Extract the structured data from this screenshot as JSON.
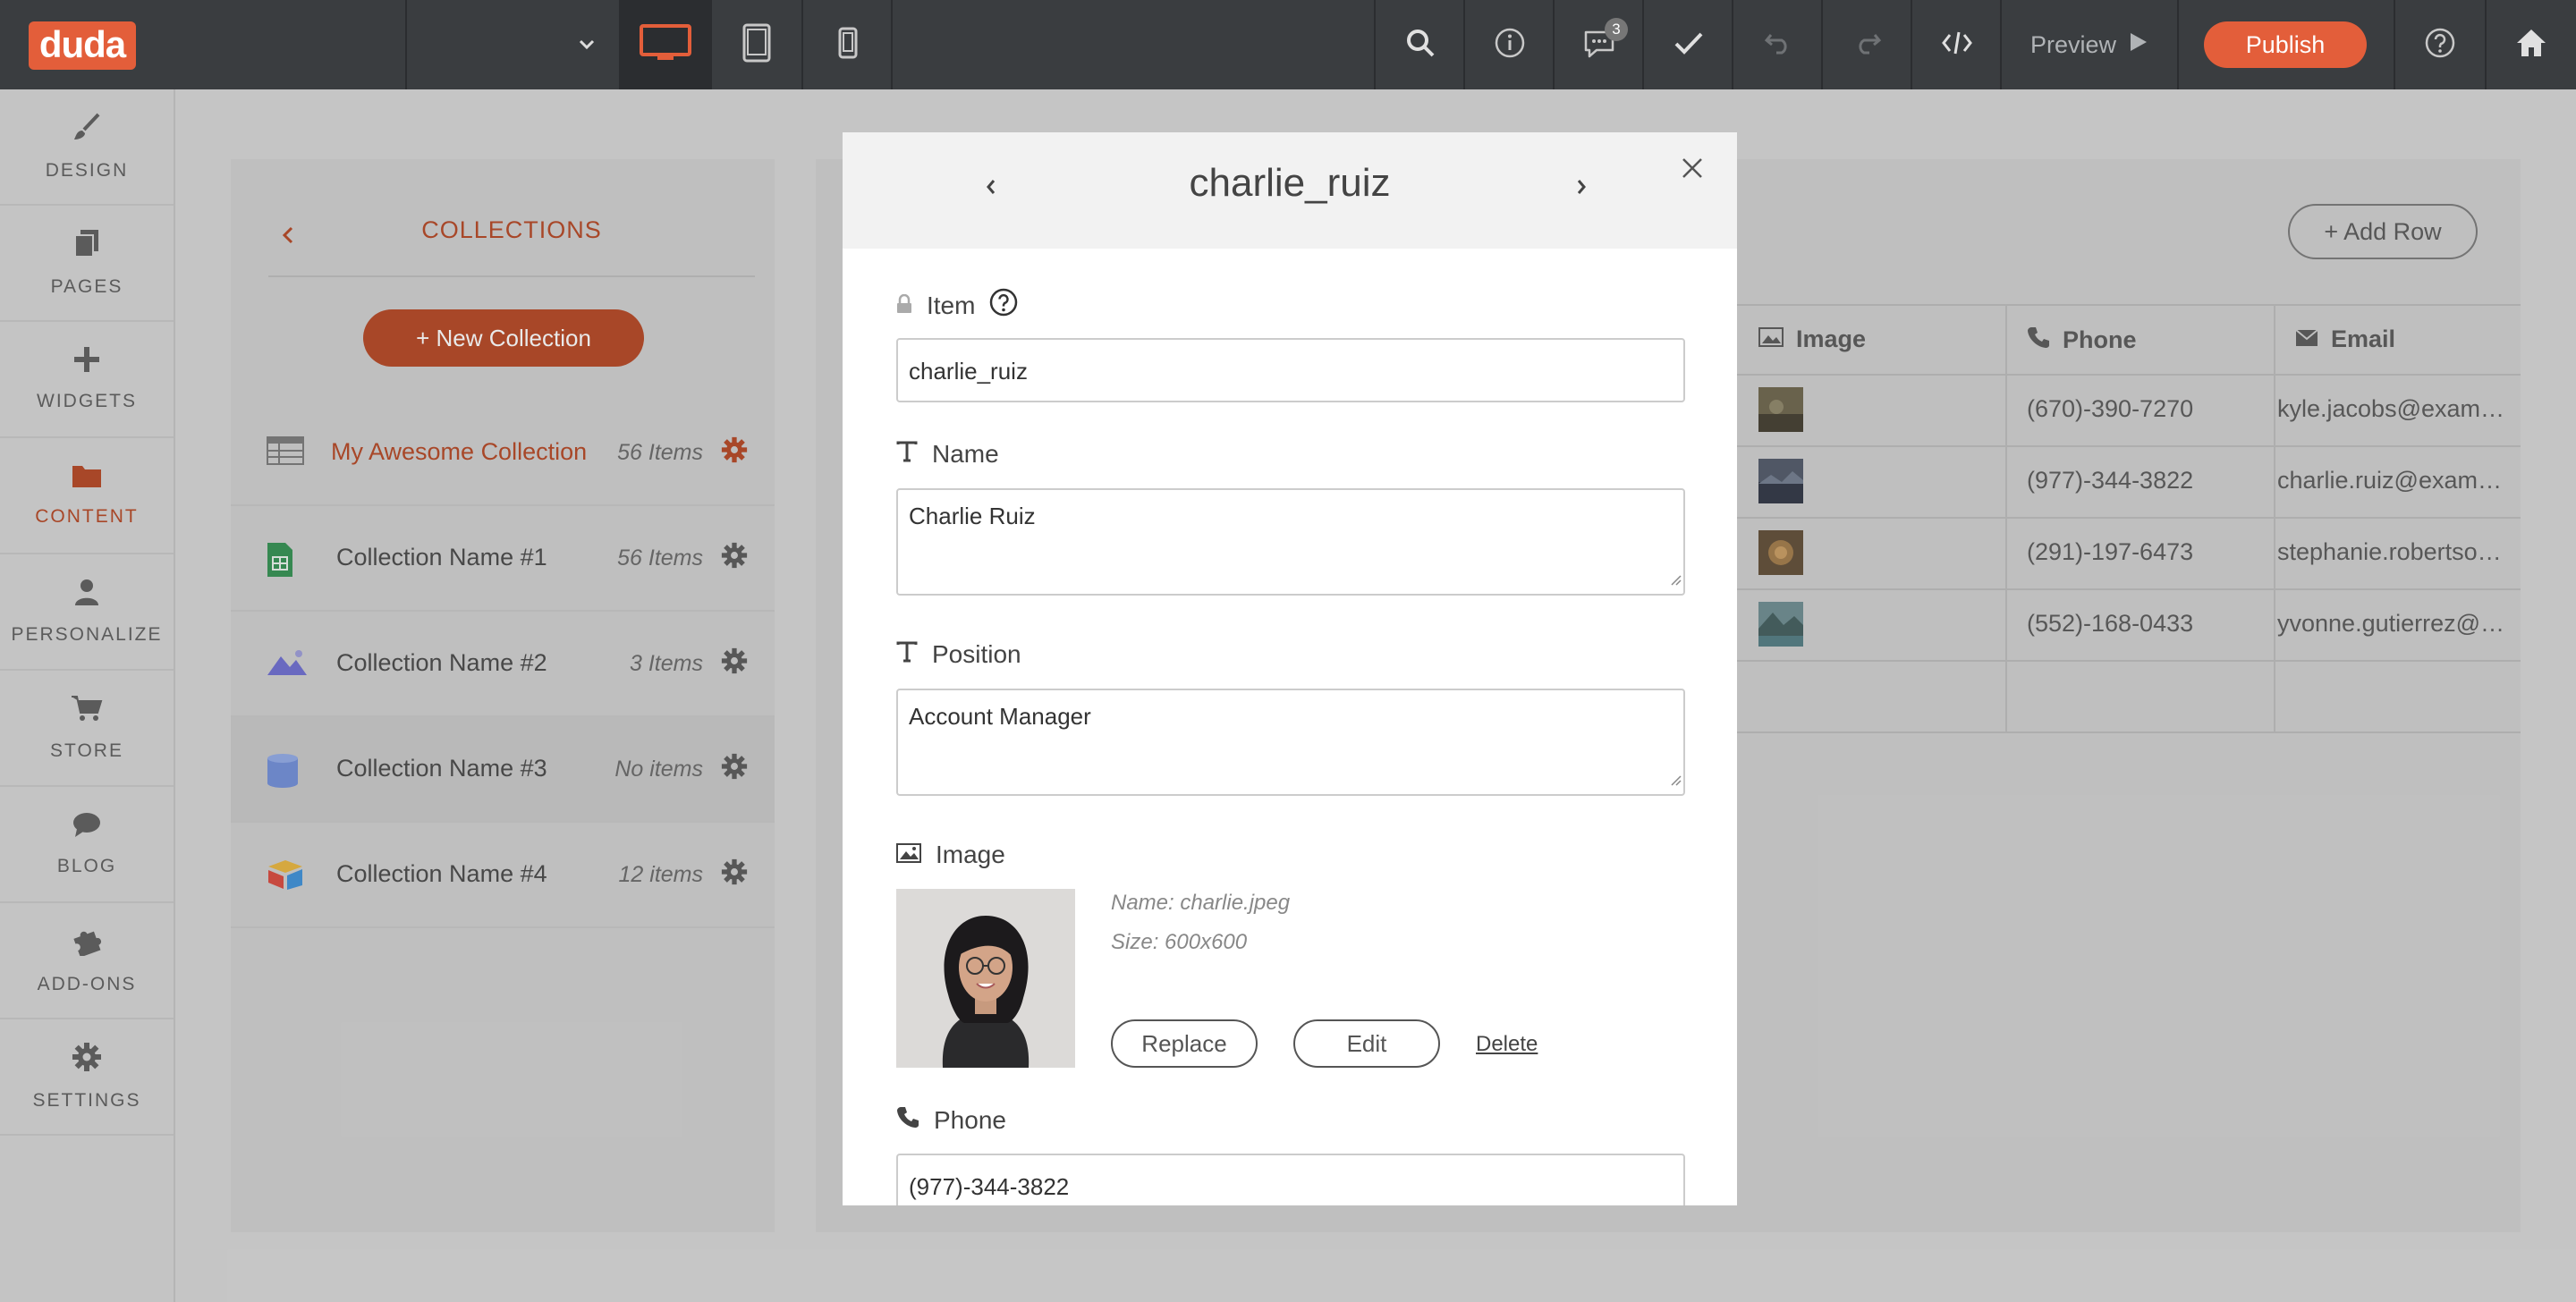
{
  "topbar": {
    "logo": "duda",
    "preview_label": "Preview",
    "publish_label": "Publish",
    "comments_count": "3"
  },
  "sidebar": {
    "items": [
      {
        "label": "DESIGN",
        "icon": "brush-icon"
      },
      {
        "label": "PAGES",
        "icon": "pages-icon"
      },
      {
        "label": "WIDGETS",
        "icon": "plus-icon"
      },
      {
        "label": "CONTENT",
        "icon": "folder-icon",
        "active": true
      },
      {
        "label": "PERSONALIZE",
        "icon": "person-icon"
      },
      {
        "label": "STORE",
        "icon": "cart-icon"
      },
      {
        "label": "BLOG",
        "icon": "chat-icon"
      },
      {
        "label": "ADD-ONS",
        "icon": "puzzle-icon"
      },
      {
        "label": "SETTINGS",
        "icon": "gear-icon"
      }
    ]
  },
  "collections": {
    "title": "COLLECTIONS",
    "new_button": "New Collection",
    "items": [
      {
        "name": "My Awesome Collection",
        "count": "56 Items",
        "icon": "table-icon"
      },
      {
        "name": "Collection Name #1",
        "count": "56 Items",
        "icon": "google-sheets-icon"
      },
      {
        "name": "Collection Name #2",
        "count": "3 Items",
        "icon": "image-icon"
      },
      {
        "name": "Collection Name #3",
        "count": "No items",
        "icon": "database-icon"
      },
      {
        "name": "Collection Name #4",
        "count": "12 items",
        "icon": "airtable-icon"
      }
    ]
  },
  "table": {
    "add_row": "Add Row",
    "columns": [
      "Image",
      "Phone",
      "Email"
    ],
    "rows": [
      {
        "phone": "(670)-390-7270",
        "email": "kyle.jacobs@exam…"
      },
      {
        "phone": "(977)-344-3822",
        "email": "charlie.ruiz@exam…"
      },
      {
        "phone": "(291)-197-6473",
        "email": "stephanie.robertso…"
      },
      {
        "phone": "(552)-168-0433",
        "email": "yvonne.gutierrez@…"
      }
    ]
  },
  "modal": {
    "title": "charlie_ruiz",
    "fields": {
      "item": {
        "label": "Item",
        "value": "charlie_ruiz"
      },
      "name": {
        "label": "Name",
        "value": "Charlie Ruiz"
      },
      "position": {
        "label": "Position",
        "value": "Account Manager"
      },
      "image": {
        "label": "Image",
        "meta_name": "Name: charlie.jpeg",
        "meta_size": "Size: 600x600",
        "replace": "Replace",
        "edit": "Edit",
        "delete": "Delete"
      },
      "phone": {
        "label": "Phone",
        "value": "(977)-344-3822"
      }
    }
  },
  "colors": {
    "accent": "#e35e3a",
    "accent_dim": "#b4431f",
    "topbar": "#3a3d40"
  }
}
